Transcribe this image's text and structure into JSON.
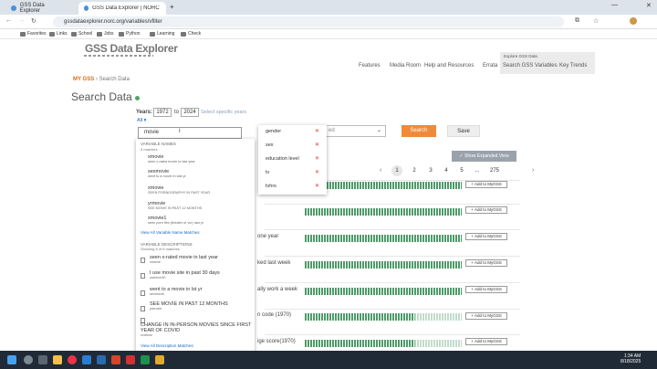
{
  "browser": {
    "tabs": [
      {
        "label": "GSS Data Explorer",
        "active": false
      },
      {
        "label": "GSS Data Explorer | NORC at th",
        "active": true
      }
    ],
    "url": "gssdataexplorer.norc.org/variables/vfilter",
    "bookmarks": [
      "Favorites",
      "Links",
      "School",
      "Jobs",
      "Python",
      "Learning",
      "Check"
    ]
  },
  "site": {
    "logo_primary": "GSS Data",
    "logo_secondary": " Explorer",
    "nav": [
      "Features",
      "Media Room",
      "Help and Resources",
      "Errata",
      "Search GSS Variables",
      "Key Trends"
    ],
    "nav_panel_label": "Explore GSS Data",
    "breadcrumb_home": "MY GSS",
    "breadcrumb_current": "Search Data",
    "page_title": "Search Data",
    "years_label": "Years:",
    "year_from": "1972",
    "year_to_label": "to",
    "year_to": "2024",
    "specific_years_link": "Select specific years",
    "all_label": "All",
    "search_value": "movie",
    "select_placeholder": "ed",
    "search_button": "Search",
    "save_button": "Save",
    "expand_button": "Show Expanded View"
  },
  "dropdown": {
    "variable_names_header": "VARIABLE NAMES",
    "variable_names_count": "5 matches",
    "variable_names": [
      {
        "name": "xmovie",
        "desc": "seen x-rated movie in last year"
      },
      {
        "name": "sexmovie",
        "desc": "went to a movie in last yr"
      },
      {
        "name": "xmovie",
        "desc": "SEEN PORNOGRAPHY IN PAST YEAR"
      },
      {
        "name": "yrmovie",
        "desc": "SEE MOVIE IN PAST 12 MONTHS"
      },
      {
        "name": "xmovie1",
        "desc": "seen porn film (theater or vcr) last yr"
      }
    ],
    "view_all_names": "View All Variable Name Matches",
    "descriptions_header": "VARIABLE DESCRIPTIONS",
    "descriptions_count": "Showing 5 of 6 matches",
    "descriptions": [
      {
        "text": "seen x-rated movie in last year",
        "var": "xmovie"
      },
      {
        "text": "I use movie site in past 30 days",
        "var": "usemov30"
      },
      {
        "text": "went to a movie in lst yr",
        "var": "sexmovie"
      },
      {
        "text": "SEE MOVIE IN PAST 12 MONTHS",
        "var": "yrmovie"
      },
      {
        "text": "CHANGE IN IN-PERSON MOVIES SINCE FIRST YEAR OF COVID",
        "var": "cvdmov"
      }
    ],
    "view_all_desc": "View All Description Matches"
  },
  "tags": [
    "gender",
    "sex",
    "education level",
    "tv",
    "tvhrs"
  ],
  "pagination": {
    "pages": [
      "1",
      "2",
      "3",
      "4",
      "5",
      "...",
      "275"
    ],
    "current": "1"
  },
  "rows": [
    {
      "label": "",
      "add": "Add to MyGSS",
      "fill": 1.0
    },
    {
      "label": "",
      "add": "Add to MyGSS",
      "fill": 1.0
    },
    {
      "label": "one year",
      "add": "Add to MyGSS",
      "fill": 1.0
    },
    {
      "label": "ked last week",
      "add": "Add to MyGSS",
      "fill": 1.0
    },
    {
      "label": "ally work a week",
      "add": "Add to MyGSS",
      "fill": 1.0
    },
    {
      "label": "n code (1970)",
      "add": "Add to MyGSS",
      "fill": 0.7
    },
    {
      "label": "ige score(1970)",
      "add": "Add to MyGSS",
      "fill": 0.7
    }
  ],
  "taskbar": {
    "time": "1:34 AM",
    "date": "8/18/2025"
  },
  "colors": {
    "accent": "#ef8a3a",
    "bar": "#4f9a6a",
    "link": "#1a66c2"
  }
}
